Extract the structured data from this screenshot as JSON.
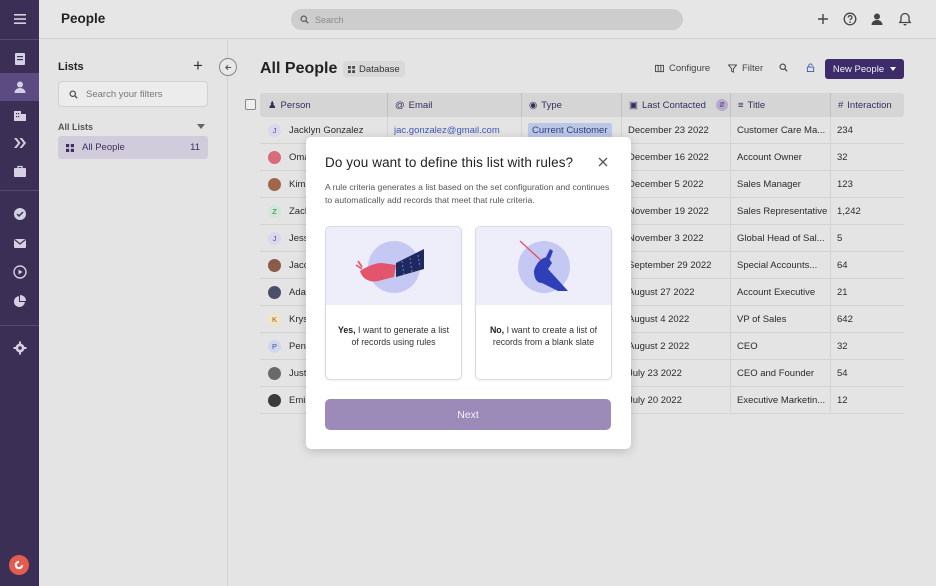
{
  "app": {
    "title": "People"
  },
  "search": {
    "placeholder": "Search"
  },
  "lists_panel": {
    "heading": "Lists",
    "filter_placeholder": "Search your filters",
    "group_label": "All Lists",
    "items": [
      {
        "label": "All People",
        "count": "11"
      }
    ]
  },
  "main": {
    "title": "All People",
    "database_badge": "Database",
    "toolbar": {
      "configure": "Configure",
      "filter": "Filter",
      "new_button": "New People"
    }
  },
  "table": {
    "columns": [
      "Person",
      "Email",
      "Type",
      "Last Contacted",
      "Title",
      "Interaction"
    ],
    "rows": [
      {
        "person": "Jacklyn Gonzalez",
        "initial": "J",
        "email": "jac.gonzalez@gmail.com",
        "type": "Current Customer",
        "last": "December 23 2022",
        "title": "Customer Care Ma...",
        "interaction": "234"
      },
      {
        "person": "Omar",
        "initial": "",
        "email": "",
        "type": "",
        "last": "December 16 2022",
        "title": "Account Owner",
        "interaction": "32"
      },
      {
        "person": "Kimb",
        "initial": "",
        "email": "",
        "type": "",
        "last": "December 5 2022",
        "title": "Sales Manager",
        "interaction": "123"
      },
      {
        "person": "Zach",
        "initial": "Z",
        "email": "",
        "type": "",
        "last": "November 19 2022",
        "title": "Sales Representative",
        "interaction": "1,242"
      },
      {
        "person": "Jessi",
        "initial": "J",
        "email": "",
        "type": "",
        "last": "November 3 2022",
        "title": "Global Head of Sal...",
        "interaction": "5"
      },
      {
        "person": "Jacol",
        "initial": "",
        "email": "",
        "type": "",
        "last": "September 29 2022",
        "title": "Special Accounts...",
        "interaction": "64"
      },
      {
        "person": "Adam",
        "initial": "",
        "email": "",
        "type": "",
        "last": "August 27 2022",
        "title": "Account Executive",
        "interaction": "21"
      },
      {
        "person": "Kryst",
        "initial": "K",
        "email": "",
        "type": "",
        "last": "August 4 2022",
        "title": "VP of Sales",
        "interaction": "642"
      },
      {
        "person": "Penn",
        "initial": "P",
        "email": "",
        "type": "",
        "last": "August 2 2022",
        "title": "CEO",
        "interaction": "32"
      },
      {
        "person": "Justin",
        "initial": "",
        "email": "",
        "type": "",
        "last": "July 23 2022",
        "title": "CEO and Founder",
        "interaction": "54"
      },
      {
        "person": "Emily",
        "initial": "",
        "email": "",
        "type": "",
        "last": "July 20 2022",
        "title": "Executive Marketin...",
        "interaction": "12"
      }
    ]
  },
  "modal": {
    "title": "Do you want to define this list with rules?",
    "description": "A rule criteria generates a list based on the set configuration and continues to automatically add records that meet that rule criteria.",
    "option_yes": {
      "bold": "Yes,",
      "text": " I want to generate a list of records using rules"
    },
    "option_no": {
      "bold": "No,",
      "text": " I want to create a list of records from a blank slate"
    },
    "next_label": "Next"
  },
  "colors": {
    "rail": "#3b2f55",
    "accent": "#3d2b6a",
    "next_button": "#9c8ab8",
    "link": "#3e5ab8"
  }
}
